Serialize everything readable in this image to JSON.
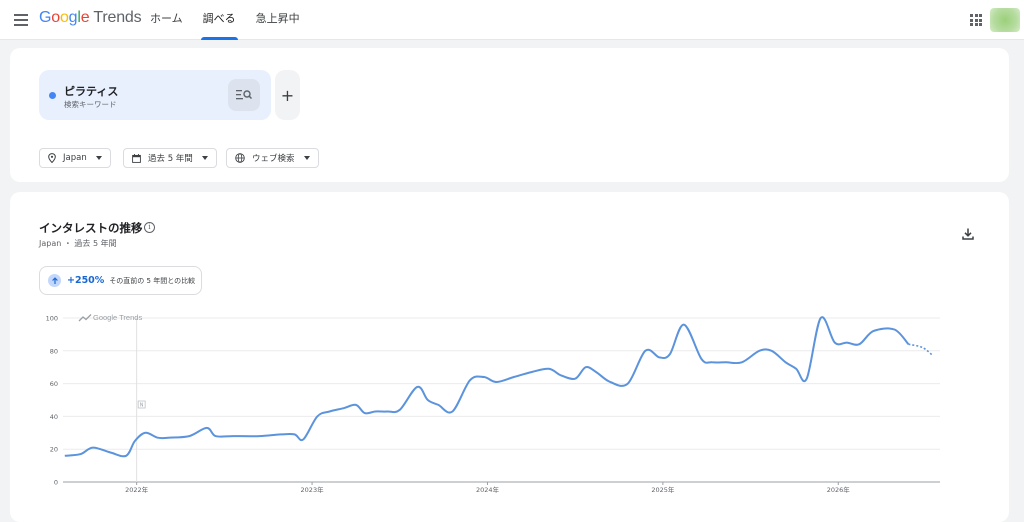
{
  "header": {
    "logo_google": [
      "G",
      "o",
      "o",
      "g",
      "l",
      "e"
    ],
    "logo_trends": "Trends",
    "nav": [
      {
        "label": "ホーム",
        "active": false
      },
      {
        "label": "調べる",
        "active": true
      },
      {
        "label": "急上昇中",
        "active": false
      }
    ]
  },
  "search": {
    "term": "ピラティス",
    "term_type": "検索キーワード",
    "add_label": "+",
    "filters": {
      "region": "Japan",
      "period": "過去 5 年間",
      "search_type": "ウェブ検索"
    }
  },
  "interest": {
    "title": "インタレストの推移",
    "info_label": "i",
    "subtitle": "Japan ・ 過去 5 年間",
    "change_value": "+250%",
    "change_label": "その直前の 5 年間との比較",
    "watermark": "Google Trends",
    "note_marker": "N"
  },
  "colors": {
    "accent": "#1a73e8",
    "series": "#5b93dc",
    "chip_bg": "#e8f0fe"
  },
  "chart_data": {
    "type": "line",
    "title": "",
    "xlabel": "",
    "ylabel": "",
    "ylim": [
      0,
      100
    ],
    "yticks": [
      0,
      20,
      40,
      60,
      80,
      100
    ],
    "xtick_labels": [
      "2022年",
      "2023年",
      "2024年",
      "2025年",
      "2026年"
    ],
    "xtick_years": [
      2022,
      2023,
      2024,
      2025,
      2026
    ],
    "x_start_year": 2021.58,
    "x_end_year": 2026.58,
    "series": [
      {
        "name": "ピラティス",
        "x": [
          2021.59,
          2021.68,
          2021.75,
          2021.85,
          2021.94,
          2021.99,
          2022.05,
          2022.12,
          2022.18,
          2022.3,
          2022.4,
          2022.45,
          2022.55,
          2022.7,
          2022.82,
          2022.9,
          2022.95,
          2023.03,
          2023.1,
          2023.18,
          2023.25,
          2023.3,
          2023.36,
          2023.43,
          2023.5,
          2023.6,
          2023.66,
          2023.72,
          2023.8,
          2023.9,
          2023.98,
          2024.05,
          2024.15,
          2024.25,
          2024.35,
          2024.42,
          2024.5,
          2024.56,
          2024.62,
          2024.7,
          2024.8,
          2024.9,
          2024.98,
          2025.04,
          2025.12,
          2025.22,
          2025.28,
          2025.36,
          2025.45,
          2025.55,
          2025.62,
          2025.7,
          2025.76,
          2025.82,
          2025.9,
          2025.98,
          2026.05,
          2026.12,
          2026.2,
          2026.32,
          2026.4,
          2026.48,
          2026.54
        ],
        "y": [
          16,
          17,
          21,
          18,
          16,
          25,
          30,
          27,
          27,
          28,
          33,
          28,
          28,
          28,
          29,
          29,
          26,
          40,
          43,
          45,
          47,
          42,
          43,
          43,
          44,
          58,
          50,
          47,
          43,
          62,
          64,
          61,
          64,
          67,
          69,
          65,
          63,
          70,
          67,
          61,
          60,
          80,
          76,
          78,
          96,
          75,
          73,
          73,
          73,
          80,
          80,
          73,
          69,
          63,
          100,
          85,
          85,
          84,
          92,
          93,
          84,
          82,
          77
        ]
      }
    ]
  }
}
